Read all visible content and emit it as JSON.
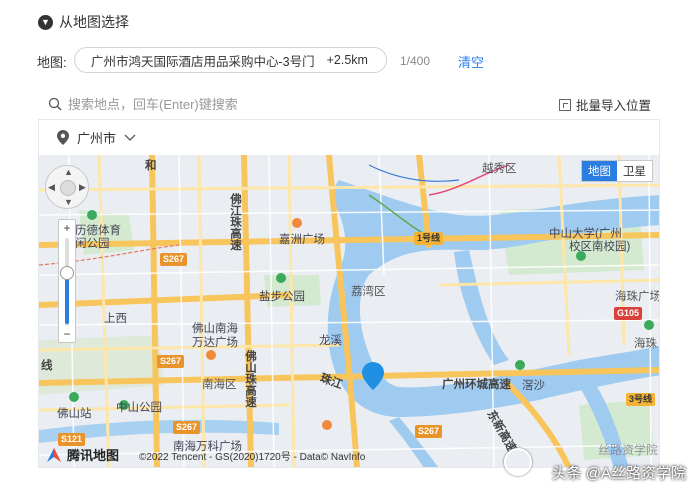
{
  "section": {
    "title": "从地图选择"
  },
  "address": {
    "label": "地图:",
    "value": "广州市鸿天国际酒店用品采购中心-3号门",
    "distance": "+2.5km",
    "char_count": "1/400",
    "clear_label": "清空"
  },
  "search": {
    "placeholder": "搜索地点，回车(Enter)键搜索",
    "batch_import_label": "批量导入位置"
  },
  "city": {
    "name": "广州市"
  },
  "map": {
    "type_options": [
      "地图",
      "卫星"
    ],
    "active_type": "地图",
    "zoom_level_fraction": 0.6,
    "brand": "腾讯地图",
    "copyright": "©2022 Tencent - GS(2020)1720号 - Data© NavInfo",
    "labels": {
      "yuexiu": "越秀区",
      "jiazhou": "嘉洲广场",
      "liwan": "荔湾区",
      "yanshan": "盐步公园",
      "longxi": "龙溪",
      "foshan_nanhai": "佛山南海",
      "wanda": "万达广场",
      "nanhai": "南海区",
      "zhongshan_park": "中山公园",
      "foshan_station": "佛山站",
      "nanhai_wanke": "南海万科广场",
      "zhujiang": "珠江",
      "guangzhou_ring": "广州环城高速",
      "haizhu_square": "海珠广场",
      "haizhu": "海珠",
      "sysu": "中山大学(广州",
      "sysu2": "校区南校园)",
      "shangxi": "上西",
      "jiaxi": "滘沙",
      "dongxin": "东新高速",
      "yujiang": "佛江珠高速",
      "fojiang": "佛山珠高速",
      "sports": "历德体育",
      "sports2": "闲公园",
      "he": "和",
      "line": "线"
    },
    "shields": {
      "s267a": "S267",
      "s267b": "S267",
      "s267c": "S267",
      "s267d": "S267",
      "s121": "S121",
      "g105": "G105",
      "line1": "1号线",
      "line3": "3号线"
    }
  },
  "watermark": {
    "text": "头条 @A丝路资学院",
    "faint": "丝路资学院"
  },
  "colors": {
    "accent": "#2a7de1",
    "water": "#9ec8ef",
    "park": "#c8e6c4",
    "road": "#f8c55c",
    "marker": "#1e8fe3"
  }
}
